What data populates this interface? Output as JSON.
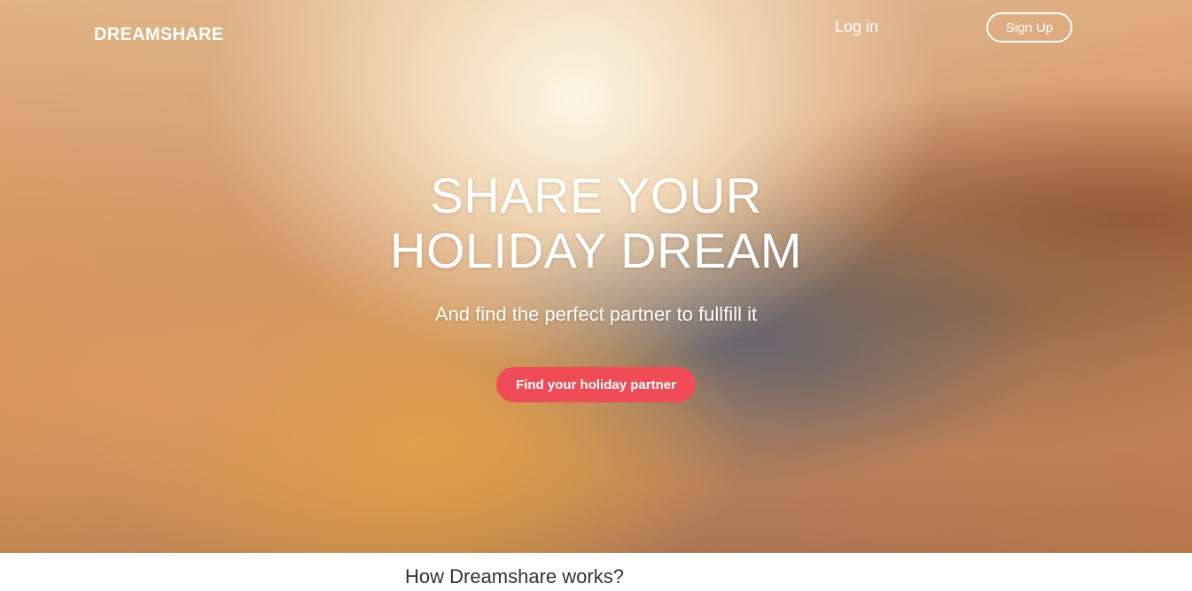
{
  "nav": {
    "logo": "DREAMSHARE",
    "login_label": "Log in",
    "signup_label": "Sign Up"
  },
  "hero": {
    "headline": "SHARE YOUR HOLIDAY DREAM",
    "subheadline": "And find the perfect partner to fullfill it",
    "cta_label": "Find your holiday partner"
  },
  "section": {
    "title": "How Dreamshare works?"
  },
  "colors": {
    "cta": "#f04c57",
    "nav_text": "#ffffff",
    "section_title": "#333333"
  }
}
